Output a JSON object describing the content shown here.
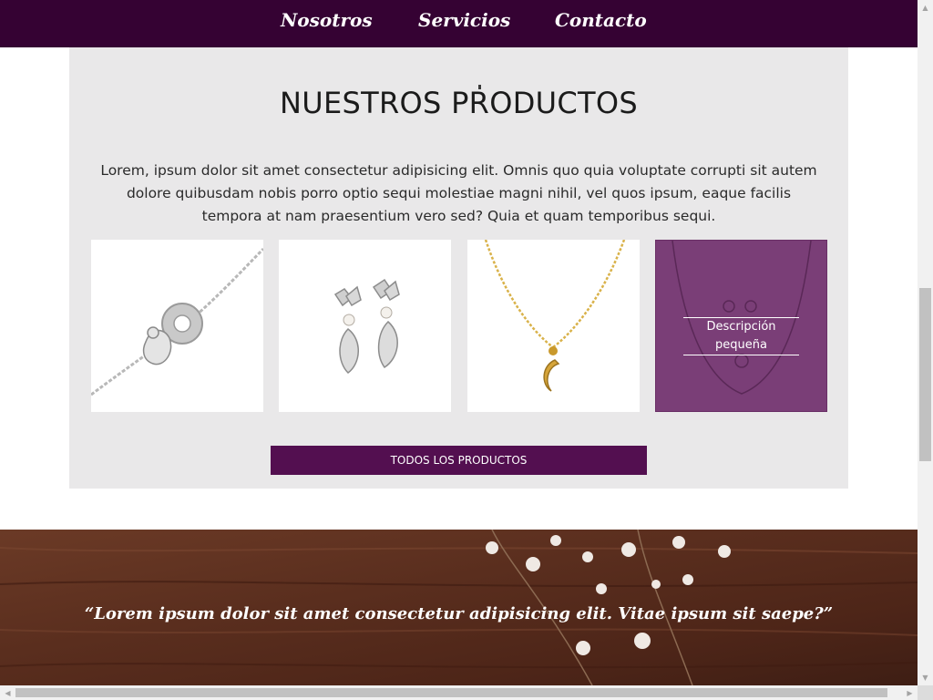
{
  "nav": {
    "links": [
      {
        "label": "Nosotros"
      },
      {
        "label": "Servicios"
      },
      {
        "label": "Contacto"
      }
    ]
  },
  "products": {
    "title": "NUESTROS PRODUCTOS",
    "description": "Lorem, ipsum dolor sit amet consectetur adipisicing elit. Omnis quo quia voluptate corrupti sit autem dolore quibusdam nobis porro optio sequi molestiae magni nihil, vel quos ipsum, eaque facilis tempora at nam praesentium vero sed? Quia et quam temporibus sequi.",
    "cards": [
      {
        "image": "bracelet"
      },
      {
        "image": "earrings"
      },
      {
        "image": "moon-necklace"
      },
      {
        "image": "necklace-hover",
        "caption": "Descripción pequeña"
      }
    ],
    "button_label": "TODOS LOS PRODUCTOS"
  },
  "quote": {
    "text": "“Lorem ipsum dolor sit amet consectetur adipisicing elit. Vitae ipsum sit saepe?”"
  },
  "colors": {
    "nav_bg": "#350233",
    "section_bg": "#e9e8e9",
    "button_bg": "#530f50",
    "hover_overlay": "#7a3e77"
  }
}
